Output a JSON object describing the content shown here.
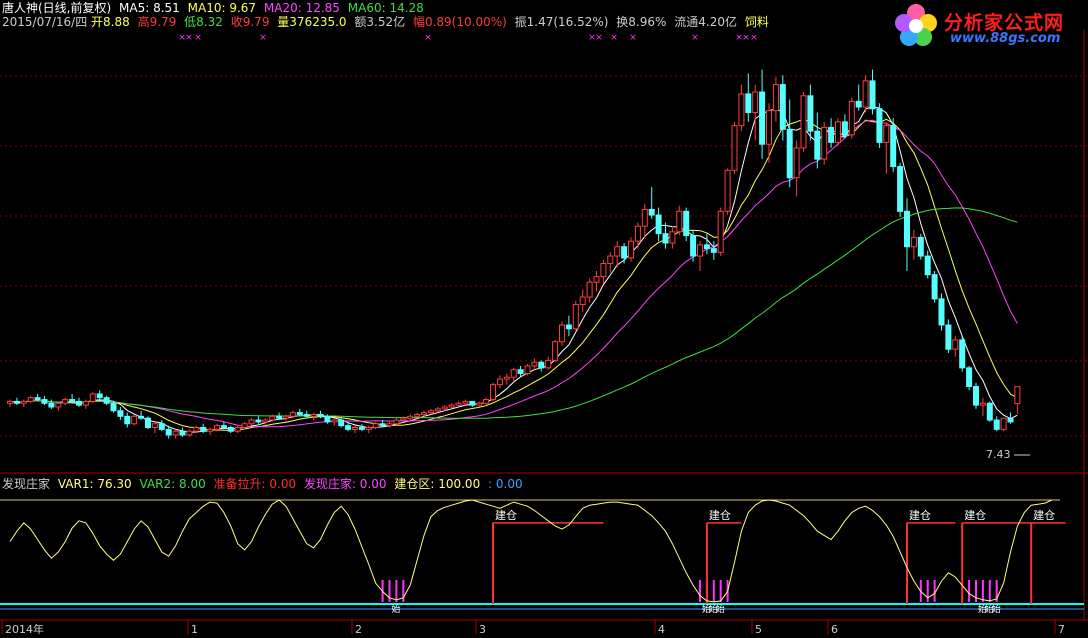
{
  "header": {
    "name": "唐人神(日线,前复权)",
    "ma5": "MA5: 8.51",
    "ma10": "MA10: 9.67",
    "ma20": "MA20: 12.85",
    "ma60": "MA60: 14.28",
    "date": "2015/07/16/四",
    "open": "开8.88",
    "high": "高9.79",
    "low": "低8.32",
    "close": "收9.79",
    "volume": "量376235.0",
    "amount": "额3.52亿",
    "change": "幅0.89(10.00%)",
    "amplitude": "振1.47(16.52%)",
    "turnover": "换8.96%",
    "float": "流通4.20亿",
    "industry": "饲料"
  },
  "indicator": {
    "name": "发现庄家",
    "var1": "VAR1: 76.30",
    "var2": "VAR2: 8.00",
    "prep": "准备拉升: 0.00",
    "dealer": "发现庄家: 0.00",
    "build_zone": "建仓区: 100.00",
    "extra": ": 0.00"
  },
  "logo": {
    "title": "分析家公式网",
    "url": "www.88gs.com"
  },
  "colors": {
    "up": "#ff3c3c",
    "down": "#54ffff",
    "ma5": "#ffffff",
    "ma10": "#ffff55",
    "ma20": "#ff44ff",
    "ma60": "#44dd44",
    "grid": "#8b0000",
    "var1": "#ffff80",
    "build": "#ff3030",
    "prep": "#ff33ff",
    "cyan_line": "#00ffff"
  },
  "chart_data": {
    "type": "candlestick",
    "y_axis_range": [
      6.5,
      28.5
    ],
    "x_tick_labels": [
      "2014年",
      "1",
      "2",
      "3",
      "4",
      "5",
      "6",
      "7"
    ],
    "annotations": {
      "low_label": "7.43",
      "build_label": "建仓",
      "dealer_label": "始"
    },
    "candles": [
      [
        8.9,
        9.1,
        8.7,
        9.0
      ],
      [
        9.0,
        9.2,
        8.8,
        8.9
      ],
      [
        8.9,
        9.1,
        8.7,
        9.0
      ],
      [
        9.0,
        9.3,
        8.9,
        9.2
      ],
      [
        9.2,
        9.4,
        9.0,
        9.1
      ],
      [
        9.1,
        9.3,
        8.8,
        8.9
      ],
      [
        8.9,
        9.1,
        8.6,
        8.7
      ],
      [
        8.7,
        9.0,
        8.5,
        8.9
      ],
      [
        8.9,
        9.2,
        8.8,
        9.1
      ],
      [
        9.1,
        9.4,
        8.9,
        9.0
      ],
      [
        9.0,
        9.2,
        8.7,
        8.8
      ],
      [
        8.8,
        9.1,
        8.6,
        9.0
      ],
      [
        9.0,
        9.5,
        8.9,
        9.4
      ],
      [
        9.4,
        9.6,
        9.1,
        9.2
      ],
      [
        9.2,
        9.3,
        8.8,
        8.9
      ],
      [
        8.9,
        9.0,
        8.4,
        8.5
      ],
      [
        8.5,
        8.7,
        8.0,
        8.2
      ],
      [
        8.2,
        8.4,
        7.6,
        7.8
      ],
      [
        7.8,
        8.3,
        7.7,
        8.2
      ],
      [
        8.2,
        8.5,
        8.0,
        8.1
      ],
      [
        8.1,
        8.2,
        7.5,
        7.6
      ],
      [
        7.6,
        7.9,
        7.3,
        7.8
      ],
      [
        7.8,
        8.0,
        7.4,
        7.5
      ],
      [
        7.5,
        7.7,
        7.0,
        7.2
      ],
      [
        7.2,
        7.5,
        7.0,
        7.4
      ],
      [
        7.4,
        7.6,
        7.1,
        7.2
      ],
      [
        7.2,
        7.5,
        7.1,
        7.4
      ],
      [
        7.4,
        7.7,
        7.3,
        7.6
      ],
      [
        7.6,
        7.8,
        7.3,
        7.4
      ],
      [
        7.4,
        7.6,
        7.2,
        7.5
      ],
      [
        7.5,
        7.8,
        7.4,
        7.7
      ],
      [
        7.7,
        7.9,
        7.5,
        7.6
      ],
      [
        7.6,
        7.7,
        7.3,
        7.4
      ],
      [
        7.4,
        7.7,
        7.3,
        7.6
      ],
      [
        7.6,
        7.9,
        7.5,
        7.8
      ],
      [
        7.8,
        8.1,
        7.7,
        8.0
      ],
      [
        8.0,
        8.2,
        7.8,
        7.9
      ],
      [
        7.9,
        8.1,
        7.7,
        8.0
      ],
      [
        8.0,
        8.3,
        7.9,
        8.2
      ],
      [
        8.2,
        8.4,
        8.0,
        8.1
      ],
      [
        8.1,
        8.3,
        7.9,
        8.2
      ],
      [
        8.2,
        8.5,
        8.1,
        8.4
      ],
      [
        8.4,
        8.6,
        8.2,
        8.3
      ],
      [
        8.3,
        8.5,
        8.1,
        8.2
      ],
      [
        8.2,
        8.4,
        8.0,
        8.3
      ],
      [
        8.3,
        8.5,
        8.1,
        8.2
      ],
      [
        8.2,
        8.3,
        7.8,
        7.9
      ],
      [
        7.9,
        8.1,
        7.7,
        8.0
      ],
      [
        8.0,
        8.1,
        7.6,
        7.7
      ],
      [
        7.7,
        7.9,
        7.4,
        7.5
      ],
      [
        7.5,
        7.7,
        7.3,
        7.6
      ],
      [
        7.6,
        7.8,
        7.4,
        7.5
      ],
      [
        7.5,
        7.7,
        7.3,
        7.6
      ],
      [
        7.6,
        7.9,
        7.5,
        7.8
      ],
      [
        7.8,
        8.0,
        7.6,
        7.7
      ],
      [
        7.7,
        7.9,
        7.6,
        7.8
      ],
      [
        7.8,
        8.1,
        7.7,
        8.0
      ],
      [
        8.0,
        8.2,
        7.9,
        8.1
      ],
      [
        8.1,
        8.3,
        8.0,
        8.2
      ],
      [
        8.2,
        8.4,
        8.1,
        8.3
      ],
      [
        8.3,
        8.5,
        8.2,
        8.4
      ],
      [
        8.4,
        8.6,
        8.3,
        8.5
      ],
      [
        8.5,
        8.7,
        8.4,
        8.6
      ],
      [
        8.6,
        8.8,
        8.5,
        8.7
      ],
      [
        8.7,
        8.9,
        8.6,
        8.8
      ],
      [
        8.8,
        9.0,
        8.7,
        8.9
      ],
      [
        8.9,
        9.1,
        8.8,
        9.0
      ],
      [
        9.0,
        9.0,
        8.7,
        8.8
      ],
      [
        8.8,
        9.0,
        8.7,
        8.9
      ],
      [
        8.9,
        9.2,
        8.8,
        9.1
      ],
      [
        9.1,
        10.0,
        9.0,
        9.9
      ],
      [
        9.9,
        10.4,
        9.7,
        10.2
      ],
      [
        10.2,
        10.5,
        9.9,
        10.3
      ],
      [
        10.3,
        10.8,
        10.1,
        10.7
      ],
      [
        10.7,
        10.9,
        10.3,
        10.5
      ],
      [
        10.5,
        11.0,
        10.4,
        10.9
      ],
      [
        10.9,
        11.3,
        10.7,
        11.1
      ],
      [
        11.1,
        11.2,
        10.6,
        10.8
      ],
      [
        10.8,
        11.4,
        10.7,
        11.2
      ],
      [
        11.2,
        12.3,
        11.1,
        12.2
      ],
      [
        12.2,
        13.3,
        12.0,
        13.1
      ],
      [
        13.1,
        13.6,
        12.5,
        12.9
      ],
      [
        12.9,
        14.4,
        12.8,
        14.2
      ],
      [
        14.2,
        15.0,
        13.8,
        14.6
      ],
      [
        14.6,
        15.6,
        14.3,
        15.4
      ],
      [
        15.4,
        16.0,
        14.9,
        15.7
      ],
      [
        15.7,
        16.6,
        15.3,
        16.4
      ],
      [
        16.4,
        17.0,
        15.9,
        16.8
      ],
      [
        16.8,
        17.6,
        16.2,
        17.3
      ],
      [
        17.3,
        17.5,
        16.4,
        16.7
      ],
      [
        16.7,
        17.8,
        16.5,
        17.6
      ],
      [
        17.6,
        18.6,
        17.2,
        18.4
      ],
      [
        18.4,
        19.6,
        17.8,
        19.3
      ],
      [
        19.3,
        20.5,
        18.8,
        19.0
      ],
      [
        19.0,
        19.4,
        17.6,
        18.0
      ],
      [
        18.0,
        18.6,
        17.2,
        17.5
      ],
      [
        17.5,
        18.4,
        17.2,
        18.1
      ],
      [
        18.1,
        19.5,
        17.9,
        19.2
      ],
      [
        19.2,
        19.4,
        17.6,
        17.9
      ],
      [
        17.9,
        18.2,
        16.5,
        16.8
      ],
      [
        16.8,
        17.6,
        16.0,
        17.4
      ],
      [
        17.4,
        18.0,
        16.9,
        17.2
      ],
      [
        17.2,
        17.6,
        16.6,
        17.0
      ],
      [
        17.0,
        19.4,
        16.8,
        19.2
      ],
      [
        19.2,
        21.5,
        19.0,
        21.4
      ],
      [
        21.4,
        24.0,
        21.2,
        23.8
      ],
      [
        23.8,
        26.0,
        23.5,
        25.5
      ],
      [
        25.5,
        26.6,
        24.0,
        24.5
      ],
      [
        24.5,
        26.0,
        23.0,
        25.6
      ],
      [
        25.6,
        26.8,
        22.0,
        22.8
      ],
      [
        22.8,
        25.0,
        21.8,
        24.6
      ],
      [
        24.6,
        26.4,
        24.0,
        26.0
      ],
      [
        26.0,
        26.5,
        23.0,
        23.6
      ],
      [
        23.6,
        25.2,
        20.5,
        21.0
      ],
      [
        21.0,
        23.0,
        20.0,
        22.6
      ],
      [
        22.6,
        25.6,
        22.4,
        25.4
      ],
      [
        25.4,
        26.0,
        23.0,
        23.5
      ],
      [
        23.5,
        24.5,
        21.5,
        22.0
      ],
      [
        22.0,
        24.0,
        21.7,
        23.7
      ],
      [
        23.7,
        24.2,
        22.6,
        22.9
      ],
      [
        22.9,
        24.2,
        22.7,
        24.0
      ],
      [
        24.0,
        24.4,
        23.1,
        23.3
      ],
      [
        23.3,
        25.3,
        23.1,
        25.1
      ],
      [
        25.1,
        26.0,
        24.6,
        24.8
      ],
      [
        24.8,
        26.5,
        24.5,
        26.2
      ],
      [
        26.2,
        26.8,
        24.4,
        24.7
      ],
      [
        24.7,
        25.0,
        22.6,
        22.9
      ],
      [
        22.9,
        24.0,
        21.2,
        23.8
      ],
      [
        23.8,
        24.2,
        21.3,
        21.6
      ],
      [
        21.6,
        21.8,
        18.9,
        19.2
      ],
      [
        19.2,
        19.9,
        16.0,
        17.3
      ],
      [
        17.3,
        18.2,
        16.6,
        17.8
      ],
      [
        17.8,
        18.0,
        16.6,
        16.8
      ],
      [
        16.8,
        17.1,
        15.6,
        15.8
      ],
      [
        15.8,
        16.0,
        14.3,
        14.5
      ],
      [
        14.5,
        14.8,
        12.8,
        13.1
      ],
      [
        13.1,
        13.4,
        11.6,
        11.8
      ],
      [
        11.8,
        12.5,
        11.4,
        12.3
      ],
      [
        12.3,
        12.5,
        10.6,
        10.8
      ],
      [
        10.8,
        10.9,
        9.6,
        9.8
      ],
      [
        9.8,
        10.0,
        8.6,
        8.8
      ],
      [
        8.8,
        9.2,
        8.2,
        8.9
      ],
      [
        8.9,
        9.0,
        7.9,
        8.0
      ],
      [
        8.0,
        8.2,
        7.4,
        7.5
      ],
      [
        7.5,
        8.1,
        7.4,
        8.1
      ],
      [
        8.1,
        8.4,
        7.8,
        7.9
      ],
      [
        8.88,
        9.79,
        8.32,
        9.79
      ]
    ],
    "var1": [
      60,
      70,
      78,
      72,
      62,
      52,
      44,
      50,
      60,
      73,
      80,
      78,
      68,
      56,
      48,
      42,
      48,
      60,
      72,
      80,
      74,
      62,
      50,
      46,
      56,
      70,
      82,
      88,
      94,
      98,
      97,
      88,
      75,
      58,
      52,
      60,
      74,
      86,
      96,
      100,
      94,
      82,
      70,
      58,
      54,
      62,
      76,
      88,
      94,
      86,
      72,
      55,
      38,
      20,
      12,
      6,
      4,
      6,
      18,
      42,
      66,
      84,
      90,
      93,
      95,
      97,
      99,
      100,
      98,
      96,
      94,
      92,
      95,
      98,
      96,
      94,
      90,
      85,
      80,
      75,
      72,
      76,
      84,
      92,
      95,
      96,
      97,
      98,
      98,
      97,
      96,
      95,
      90,
      85,
      78,
      70,
      58,
      44,
      30,
      18,
      8,
      3,
      2,
      3,
      12,
      40,
      70,
      88,
      95,
      99,
      100,
      99,
      97,
      95,
      90,
      85,
      78,
      70,
      66,
      62,
      70,
      80,
      88,
      92,
      94,
      90,
      84,
      76,
      65,
      50,
      35,
      22,
      12,
      6,
      10,
      22,
      30,
      26,
      18,
      10,
      6,
      4,
      3,
      5,
      20,
      50,
      75,
      88,
      95,
      96,
      97,
      100
    ],
    "build_positions": [
      70,
      101,
      130,
      138,
      148
    ],
    "build_levels": [
      [
        70,
        86
      ],
      [
        101,
        106
      ],
      [
        130,
        137
      ],
      [
        138,
        148
      ],
      [
        148,
        153
      ]
    ]
  }
}
